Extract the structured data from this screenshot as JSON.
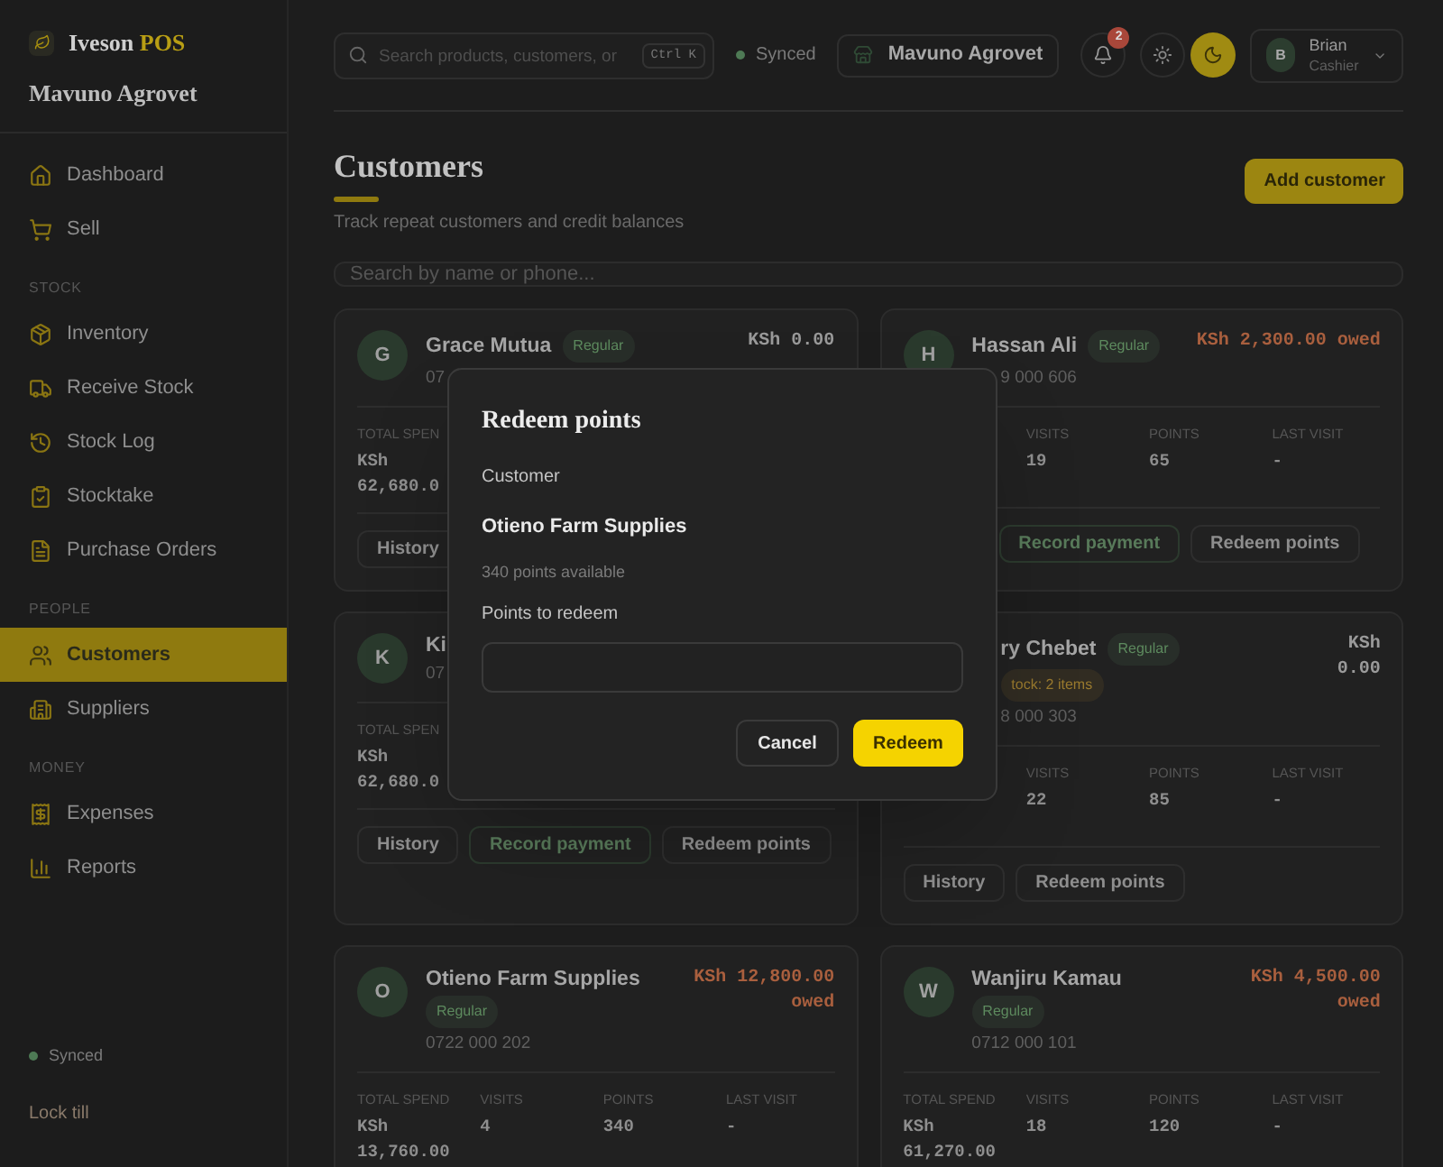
{
  "brand": {
    "name": "Iveson",
    "suffix": "POS",
    "store": "Mavuno Agrovet"
  },
  "sidebar": {
    "sections": [
      {
        "items": [
          {
            "label": "Dashboard",
            "selected": false
          },
          {
            "label": "Sell",
            "selected": false
          }
        ]
      },
      {
        "label": "STOCK",
        "items": [
          {
            "label": "Inventory",
            "selected": false
          },
          {
            "label": "Receive Stock",
            "selected": false
          },
          {
            "label": "Stock Log",
            "selected": false
          },
          {
            "label": "Stocktake",
            "selected": false
          },
          {
            "label": "Purchase Orders",
            "selected": false
          }
        ]
      },
      {
        "label": "PEOPLE",
        "items": [
          {
            "label": "Customers",
            "selected": true
          },
          {
            "label": "Suppliers",
            "selected": false
          }
        ]
      },
      {
        "label": "MONEY",
        "items": [
          {
            "label": "Expenses",
            "selected": false
          },
          {
            "label": "Reports",
            "selected": false
          }
        ]
      }
    ],
    "sync_status": "Synced",
    "lock": "Lock till"
  },
  "topbar": {
    "search": {
      "placeholder": "Search products, customers, or",
      "shortcut": "Ctrl K"
    },
    "sync_status": "Synced",
    "store": "Mavuno Agrovet",
    "notifications": "2",
    "theme": [
      {
        "kind": "light",
        "selected": false
      },
      {
        "kind": "dark",
        "selected": true
      }
    ],
    "user": {
      "initial": "B",
      "name": "Brian",
      "role": "Cashier"
    }
  },
  "page": {
    "title": "Customers",
    "subtitle": "Track repeat customers and credit balances",
    "add_button": "Add customer",
    "search": {
      "placeholder": "Search by name or phone..."
    }
  },
  "customers": [
    {
      "avatar": "G",
      "name": "Grace Mutua",
      "badges": [
        {
          "text": "Regular",
          "color": "#5d8a5e"
        }
      ],
      "phone": "07",
      "balance": {
        "text": "KSh 0.00",
        "kind": "clear"
      },
      "stats": {
        "total_spend": {
          "label": "TOTAL SPEN",
          "value": "KSh 62,680.0"
        }
      },
      "actions": [
        {
          "label": "History",
          "kind": "history"
        }
      ]
    },
    {
      "avatar": "H",
      "name": "Hassan Ali",
      "badges": [
        {
          "text": "Regular",
          "color": "#5d8a5e"
        }
      ],
      "phone": "9 000 606",
      "balance": {
        "text": "KSh 2,300.00 owed",
        "kind": "owed"
      },
      "stats": {
        "visits": {
          "label": "VISITS",
          "value": "19"
        },
        "points": {
          "label": "POINTS",
          "value": "65"
        },
        "last_visit": {
          "label": "LAST VISIT",
          "value": "-"
        }
      },
      "actions": [
        {
          "label": "Record payment",
          "kind": "payment"
        },
        {
          "label": "Redeem points",
          "kind": "redeem"
        }
      ]
    },
    {
      "avatar": "K",
      "name": "Ki",
      "phone": "07",
      "stats": {
        "total_spend": {
          "label": "TOTAL SPEN",
          "value": "KSh 62,680.0"
        }
      },
      "actions": [
        {
          "label": "History",
          "kind": "history"
        },
        {
          "label": "Record payment",
          "kind": "payment"
        },
        {
          "label": "Redeem points",
          "kind": "redeem"
        }
      ]
    },
    {
      "name": "ry Chebet",
      "badges": [
        {
          "text": "Regular",
          "color": "#5d8a5e"
        },
        {
          "text": "tock: 2 items",
          "color": "#9a7a2e"
        }
      ],
      "phone": "8 000 303",
      "balance": {
        "text": "KSh 0.00",
        "kind": "clear"
      },
      "stats": {
        "visits": {
          "label": "VISITS",
          "value": "22"
        },
        "points": {
          "label": "POINTS",
          "value": "85"
        },
        "last_visit": {
          "label": "LAST VISIT",
          "value": "-"
        }
      },
      "actions": [
        {
          "label": "History",
          "kind": "history"
        },
        {
          "label": "Redeem points",
          "kind": "redeem"
        }
      ]
    },
    {
      "avatar": "O",
      "name": "Otieno Farm Supplies",
      "badges": [
        {
          "text": "Regular",
          "color": "#5d8a5e"
        }
      ],
      "phone": "0722 000 202",
      "balance": {
        "text": "KSh 12,800.00 owed",
        "kind": "owed"
      },
      "stats": {
        "total_spend": {
          "label": "TOTAL SPEND",
          "value": "KSh 13,760.00"
        },
        "visits": {
          "label": "VISITS",
          "value": "4"
        },
        "points": {
          "label": "POINTS",
          "value": "340"
        },
        "last_visit": {
          "label": "LAST VISIT",
          "value": "-"
        }
      }
    },
    {
      "avatar": "W",
      "name": "Wanjiru Kamau",
      "badges": [
        {
          "text": "Regular",
          "color": "#5d8a5e"
        }
      ],
      "phone": "0712 000 101",
      "balance": {
        "text": "KSh 4,500.00 owed",
        "kind": "owed"
      },
      "stats": {
        "total_spend": {
          "label": "TOTAL SPEND",
          "value": "KSh 61,270.00"
        },
        "visits": {
          "label": "VISITS",
          "value": "18"
        },
        "points": {
          "label": "POINTS",
          "value": "120"
        },
        "last_visit": {
          "label": "LAST VISIT",
          "value": "-"
        }
      }
    }
  ],
  "dialog": {
    "title": "Redeem points",
    "customer_label": "Customer",
    "customer": "Otieno Farm Supplies",
    "available": "340 points available",
    "field_label": "Points to redeem",
    "buttons": [
      {
        "label": "Cancel",
        "kind": "cancel"
      },
      {
        "label": "Redeem",
        "kind": "primary"
      }
    ]
  }
}
